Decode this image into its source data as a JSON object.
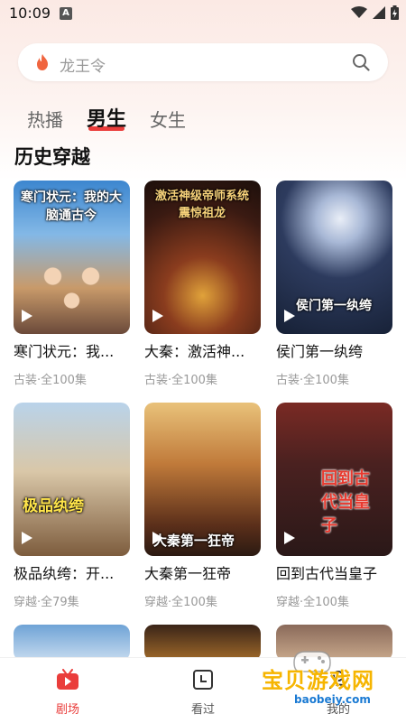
{
  "status_bar": {
    "time": "10:09",
    "notification_icon": "A"
  },
  "search": {
    "placeholder": "龙王令"
  },
  "tabs": [
    {
      "label": "热播",
      "active": false
    },
    {
      "label": "男生",
      "active": true
    },
    {
      "label": "女生",
      "active": false
    }
  ],
  "section": {
    "title": "历史穿越"
  },
  "dramas": [
    {
      "title": "寒门状元：我...",
      "meta": "古装·全100集",
      "poster_text": "寒门状元：我的大脑通古今"
    },
    {
      "title": "大秦：激活神...",
      "meta": "古装·全100集",
      "poster_text": "激活神级帝师系统 震惊祖龙"
    },
    {
      "title": "侯门第一纨绔",
      "meta": "古装·全100集",
      "poster_text": "侯门第一纨绔"
    },
    {
      "title": "极品纨绔：开...",
      "meta": "穿越·全79集",
      "poster_text": "极品纨绔"
    },
    {
      "title": "大秦第一狂帝",
      "meta": "穿越·全100集",
      "poster_text": "大秦第一狂帝"
    },
    {
      "title": "回到古代当皇子",
      "meta": "穿越·全100集",
      "poster_text": "回到古代当皇子"
    }
  ],
  "bottom_nav": [
    {
      "label": "剧场",
      "icon": "tv-play-icon",
      "active": true
    },
    {
      "label": "看过",
      "icon": "history-icon",
      "active": false
    },
    {
      "label": "我的",
      "icon": "profile-icon",
      "active": false
    }
  ],
  "watermark": {
    "text": "宝贝游戏网",
    "url": "baobeiy.com"
  },
  "colors": {
    "accent": "#ea3d3b",
    "watermark": "#f6b500"
  }
}
